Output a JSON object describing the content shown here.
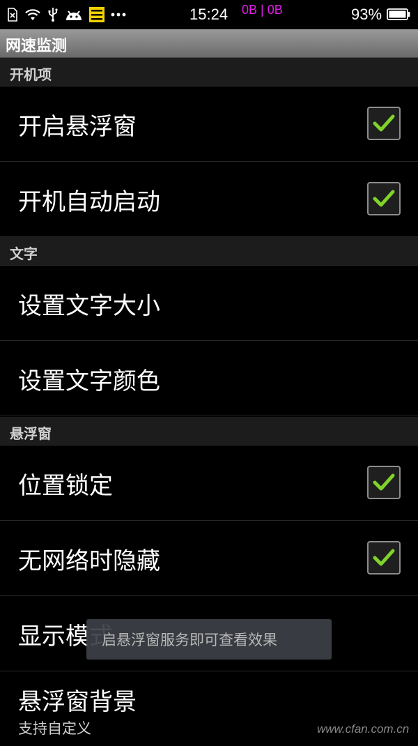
{
  "statusbar": {
    "time": "15:24",
    "net_speed": "0B | 0B",
    "battery_percent": "93%",
    "icons": [
      "sim-off-icon",
      "wifi-icon",
      "usb-icon",
      "android-icon",
      "notification-list-icon",
      "more-icon"
    ]
  },
  "app": {
    "title": "网速监测"
  },
  "sections": [
    {
      "header": "开机项"
    },
    {
      "header": "文字"
    },
    {
      "header": "悬浮窗"
    }
  ],
  "settings": {
    "float_window": {
      "label": "开启悬浮窗",
      "checked": true
    },
    "auto_start": {
      "label": "开机自动启动",
      "checked": true
    },
    "text_size": {
      "label": "设置文字大小"
    },
    "text_color": {
      "label": "设置文字颜色"
    },
    "lock_position": {
      "label": "位置锁定",
      "checked": true
    },
    "hide_no_network": {
      "label": "无网络时隐藏",
      "checked": true
    },
    "display_mode": {
      "label": "显示模式"
    },
    "float_bg": {
      "label": "悬浮窗背景",
      "summary": "支持自定义"
    }
  },
  "toast": {
    "text": "启悬浮窗服务即可查看效果"
  },
  "watermark": "www.cfan.com.cn",
  "colors": {
    "accent_check": "#7fd32a",
    "net_speed": "#e21ee5"
  }
}
